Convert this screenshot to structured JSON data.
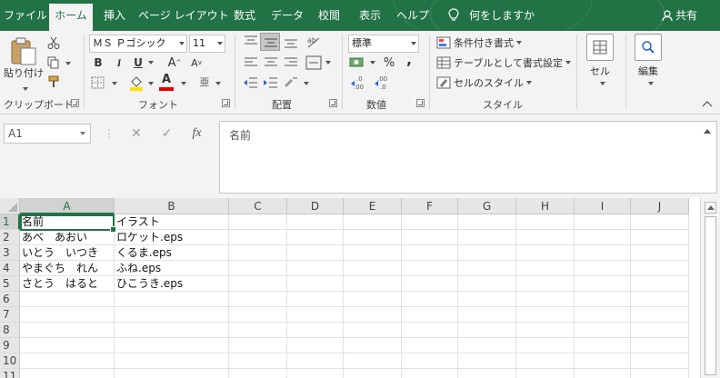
{
  "ribbon_tabs": [
    "ファイル",
    "ホーム",
    "挿入",
    "ページ レイアウト",
    "数式",
    "データ",
    "校閲",
    "表示",
    "ヘルプ"
  ],
  "active_tab": "ホーム",
  "tell_me": "何をしますか",
  "share": "共有",
  "clipboard": {
    "paste": "貼り付け",
    "label": "クリップボード"
  },
  "font": {
    "name": "ＭＳ Ｐゴシック",
    "size": "11",
    "bold": "B",
    "italic": "I",
    "underline": "U",
    "grow": "A",
    "shrink": "A",
    "color_a": "A",
    "phonetic": "亜",
    "label": "フォント"
  },
  "alignment": {
    "label": "配置"
  },
  "number": {
    "format": "標準",
    "percent": "%",
    "comma": ",",
    "label": "数値"
  },
  "styles": {
    "conditional": "条件付き書式",
    "table": "テーブルとして書式設定",
    "cell_style": "セルのスタイル",
    "label": "スタイル"
  },
  "cells": {
    "label": "セル"
  },
  "editing": {
    "label": "編集"
  },
  "name_box": "A1",
  "formula_bar": "名前",
  "fx": "fx",
  "columns": [
    "A",
    "B",
    "C",
    "D",
    "E",
    "F",
    "G",
    "H",
    "I",
    "J"
  ],
  "rows": [
    "1",
    "2",
    "3",
    "4",
    "5",
    "6",
    "7",
    "8",
    "9",
    "10",
    "11"
  ],
  "sheet": [
    [
      "名前",
      "イラスト"
    ],
    [
      "あべ　あおい",
      "ロケット.eps"
    ],
    [
      "いとう　いつき",
      "くるま.eps"
    ],
    [
      "やまぐち　れん",
      "ふね.eps"
    ],
    [
      "さとう　はると",
      "ひこうき.eps"
    ]
  ],
  "colors": {
    "excel_green": "#217346",
    "ribbon_bg": "#f3f3f3",
    "header_bg": "#e6e6e6",
    "fill_yellow": "#ffe000",
    "font_red": "#e00000"
  }
}
